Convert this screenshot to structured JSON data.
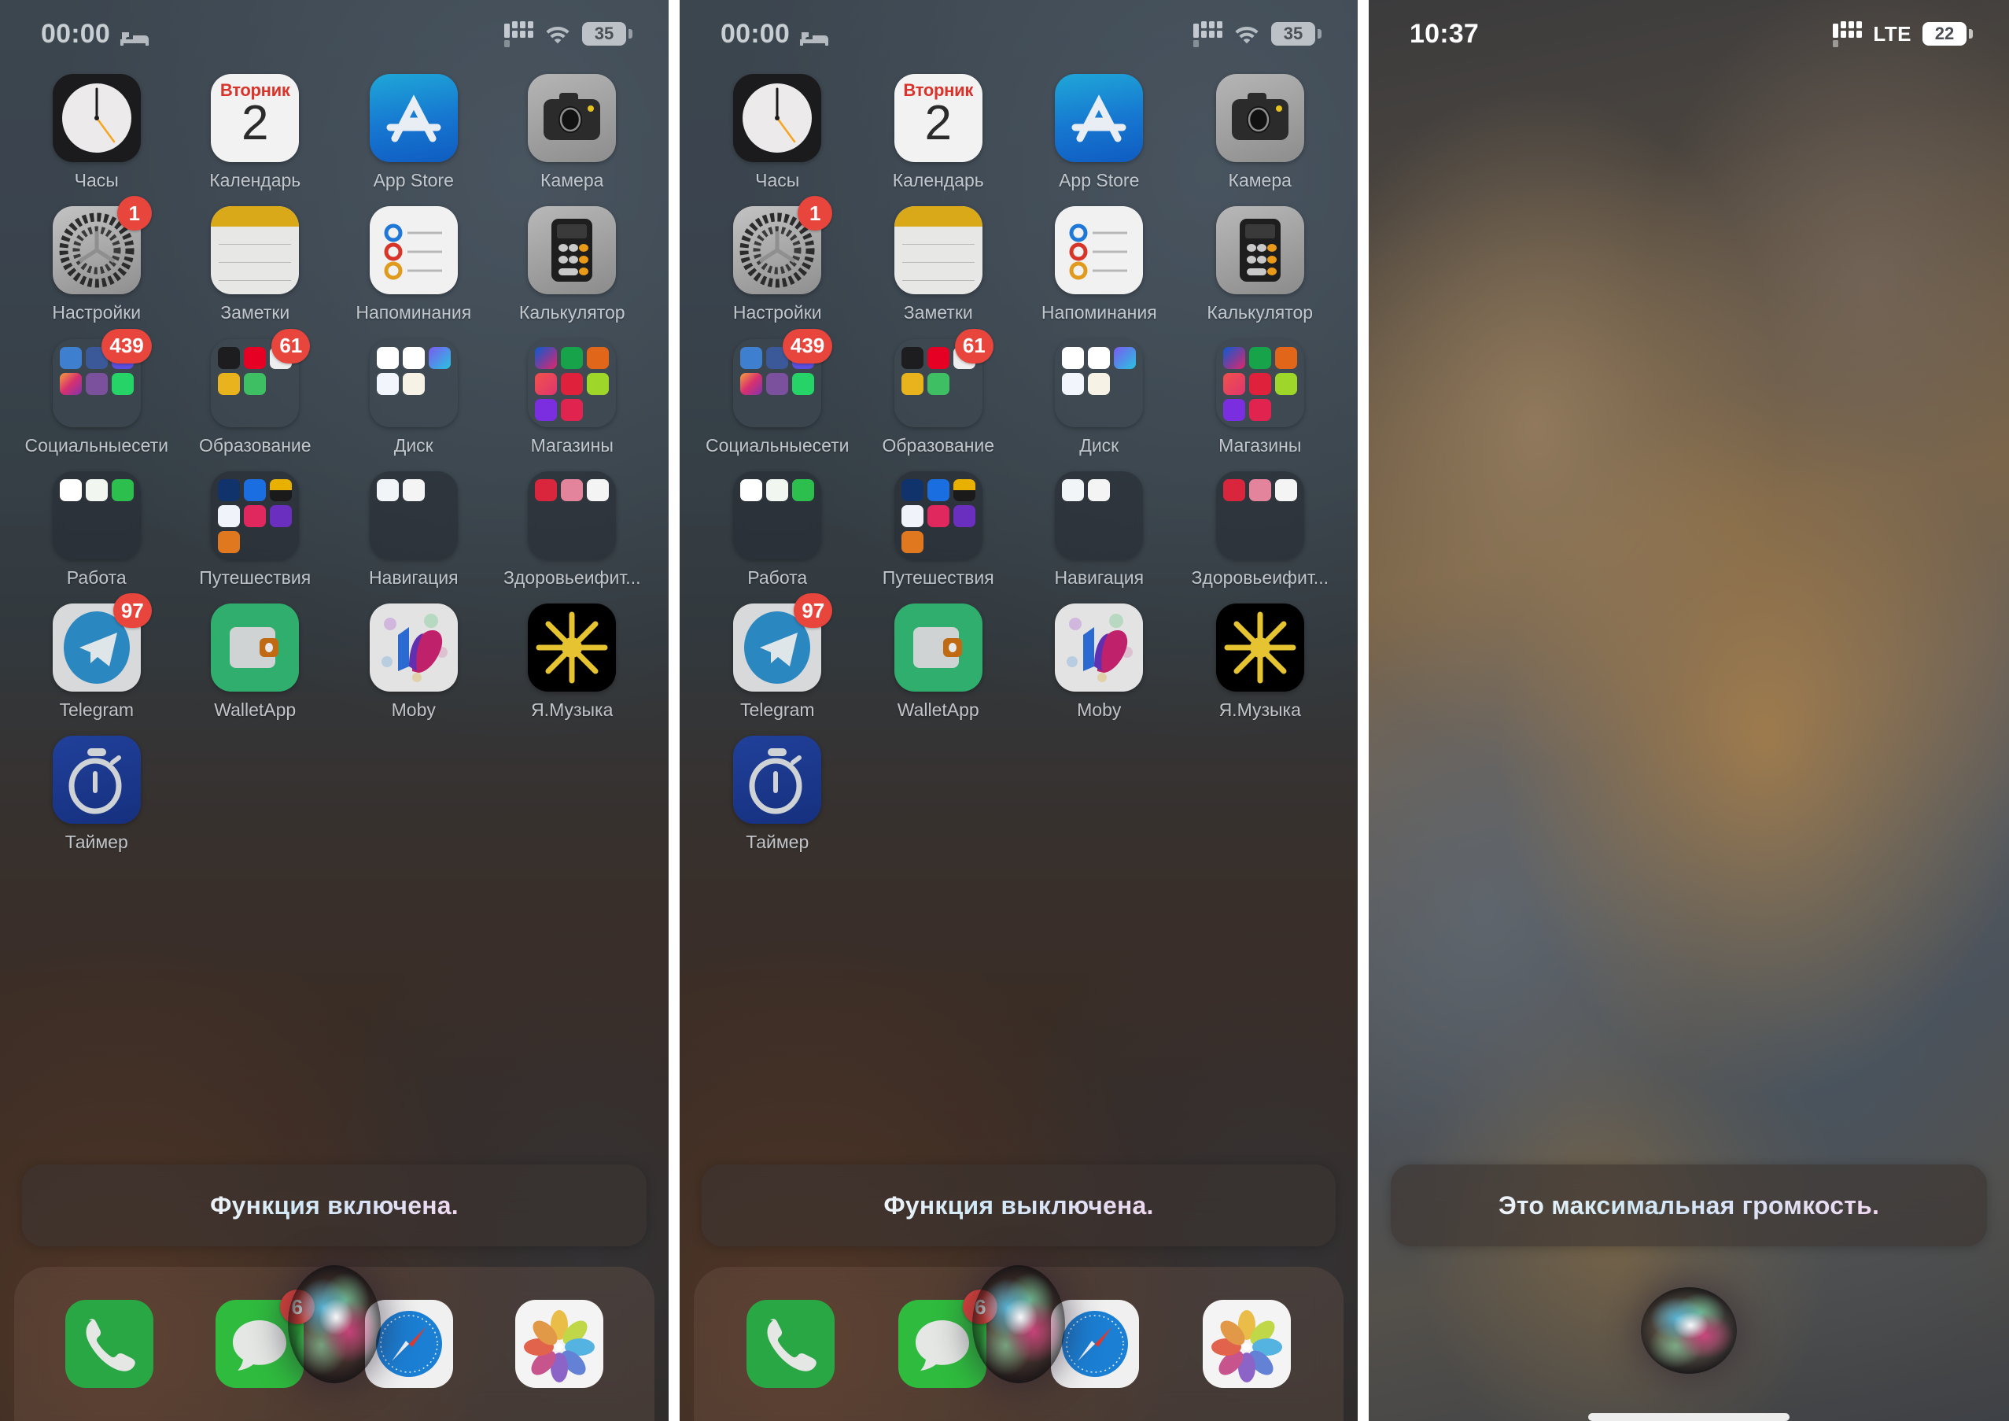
{
  "panels": [
    {
      "id": "panel-siri-on",
      "status": {
        "time": "00:00",
        "sleep_icon": "bed-icon",
        "cellular_icon": "cellular-dots-icon",
        "wifi_icon": "wifi-icon",
        "battery": "35",
        "carrier": ""
      },
      "siri_response": "Функция включена.",
      "apps": [
        {
          "name": "Часы",
          "badge": ""
        },
        {
          "name": "Календарь",
          "badge": "",
          "cal_weekday": "Вторник",
          "cal_day": "2"
        },
        {
          "name": "App Store",
          "badge": ""
        },
        {
          "name": "Камера",
          "badge": ""
        },
        {
          "name": "Настройки",
          "badge": "1"
        },
        {
          "name": "Заметки",
          "badge": ""
        },
        {
          "name": "Напоминания",
          "badge": ""
        },
        {
          "name": "Калькулятор",
          "badge": ""
        },
        {
          "name": "Социальныесети",
          "badge": "439"
        },
        {
          "name": "Образование",
          "badge": "61"
        },
        {
          "name": "Диск",
          "badge": ""
        },
        {
          "name": "Магазины",
          "badge": ""
        },
        {
          "name": "Работа",
          "badge": ""
        },
        {
          "name": "Путешествия",
          "badge": ""
        },
        {
          "name": "Навигация",
          "badge": ""
        },
        {
          "name": "Здоровьеифит...",
          "badge": ""
        },
        {
          "name": "Telegram",
          "badge": "97"
        },
        {
          "name": "WalletApp",
          "badge": ""
        },
        {
          "name": "Moby",
          "badge": ""
        },
        {
          "name": "Я.Музыка",
          "badge": ""
        },
        {
          "name": "Таймер",
          "badge": ""
        }
      ],
      "dock": [
        {
          "name": "Телефон",
          "badge": ""
        },
        {
          "name": "Сообщения",
          "badge": "6"
        },
        {
          "name": "Safari",
          "badge": ""
        },
        {
          "name": "Фото",
          "badge": ""
        }
      ]
    },
    {
      "id": "panel-siri-off",
      "status": {
        "time": "00:00",
        "sleep_icon": "bed-icon",
        "cellular_icon": "cellular-dots-icon",
        "wifi_icon": "wifi-icon",
        "battery": "35",
        "carrier": ""
      },
      "siri_response": "Функция выключена.",
      "apps": [
        {
          "name": "Часы",
          "badge": ""
        },
        {
          "name": "Календарь",
          "badge": "",
          "cal_weekday": "Вторник",
          "cal_day": "2"
        },
        {
          "name": "App Store",
          "badge": ""
        },
        {
          "name": "Камера",
          "badge": ""
        },
        {
          "name": "Настройки",
          "badge": "1"
        },
        {
          "name": "Заметки",
          "badge": ""
        },
        {
          "name": "Напоминания",
          "badge": ""
        },
        {
          "name": "Калькулятор",
          "badge": ""
        },
        {
          "name": "Социальныесети",
          "badge": "439"
        },
        {
          "name": "Образование",
          "badge": "61"
        },
        {
          "name": "Диск",
          "badge": ""
        },
        {
          "name": "Магазины",
          "badge": ""
        },
        {
          "name": "Работа",
          "badge": ""
        },
        {
          "name": "Путешествия",
          "badge": ""
        },
        {
          "name": "Навигация",
          "badge": ""
        },
        {
          "name": "Здоровьеифит...",
          "badge": ""
        },
        {
          "name": "Telegram",
          "badge": "97"
        },
        {
          "name": "WalletApp",
          "badge": ""
        },
        {
          "name": "Moby",
          "badge": ""
        },
        {
          "name": "Я.Музыка",
          "badge": ""
        },
        {
          "name": "Таймер",
          "badge": ""
        }
      ],
      "dock": [
        {
          "name": "Телефон",
          "badge": ""
        },
        {
          "name": "Сообщения",
          "badge": "6"
        },
        {
          "name": "Safari",
          "badge": ""
        },
        {
          "name": "Фото",
          "badge": ""
        }
      ]
    },
    {
      "id": "panel-siri-volume",
      "status": {
        "time": "10:37",
        "sleep_icon": "",
        "cellular_icon": "cellular-dots-icon",
        "wifi_icon": "",
        "battery": "22",
        "carrier": "LTE"
      },
      "siri_response": "Это максимальная громкость."
    }
  ],
  "colors": {
    "badge_red": "#e8453c",
    "siri_banner_bg": "#3c3430",
    "label_text": "#d6dbe0"
  }
}
